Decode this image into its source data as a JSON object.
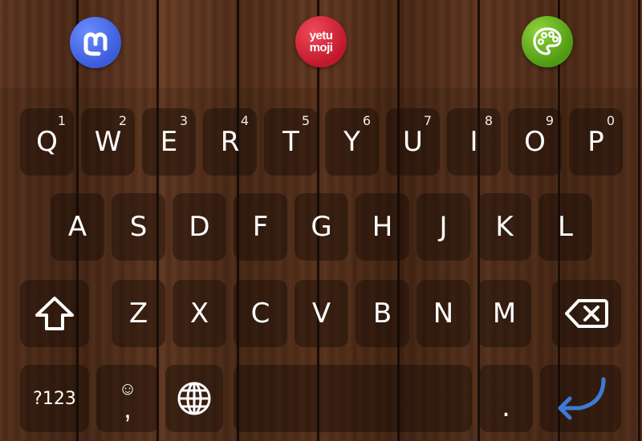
{
  "app_shortcuts": [
    {
      "name": "mastodon-icon",
      "glyph": "m"
    },
    {
      "name": "yetumoji-icon",
      "line1": "yetu",
      "line2": "moji"
    },
    {
      "name": "palette-icon"
    }
  ],
  "row1": [
    {
      "letter": "Q",
      "hint": "1"
    },
    {
      "letter": "W",
      "hint": "2"
    },
    {
      "letter": "E",
      "hint": "3"
    },
    {
      "letter": "R",
      "hint": "4"
    },
    {
      "letter": "T",
      "hint": "5"
    },
    {
      "letter": "Y",
      "hint": "6"
    },
    {
      "letter": "U",
      "hint": "7"
    },
    {
      "letter": "I",
      "hint": "8"
    },
    {
      "letter": "O",
      "hint": "9"
    },
    {
      "letter": "P",
      "hint": "0"
    }
  ],
  "row2": [
    "A",
    "S",
    "D",
    "F",
    "G",
    "H",
    "J",
    "K",
    "L"
  ],
  "row3": [
    "Z",
    "X",
    "C",
    "V",
    "B",
    "N",
    "M"
  ],
  "bottom": {
    "symbols_label": "?123",
    "emoji_glyph": "☺",
    "comma_label": ",",
    "period_label": "."
  },
  "colors": {
    "enter_arrow": "#3a7bd5",
    "key_text": "#ffffff"
  }
}
